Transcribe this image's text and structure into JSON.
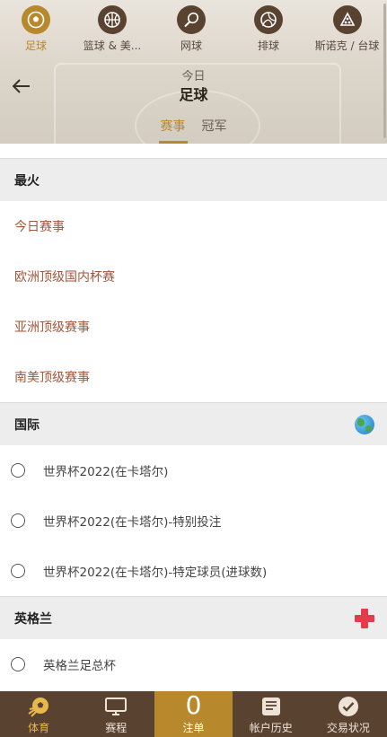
{
  "sports": [
    {
      "label": "足球",
      "icon": "soccer-ball-icon",
      "active": true
    },
    {
      "label": "篮球 & 美...",
      "icon": "basketball-icon",
      "active": false
    },
    {
      "label": "网球",
      "icon": "tennis-icon",
      "active": false
    },
    {
      "label": "排球",
      "icon": "volleyball-icon",
      "active": false
    },
    {
      "label": "斯诺克 / 台球",
      "icon": "snooker-icon",
      "active": false
    }
  ],
  "header": {
    "subtitle": "今日",
    "title": "足球"
  },
  "tabs": [
    {
      "label": "赛事",
      "active": true
    },
    {
      "label": "冠军",
      "active": false
    }
  ],
  "sections": {
    "hot": {
      "title": "最火",
      "items": [
        "今日赛事",
        "欧洲顶级国内杯赛",
        "亚洲顶级赛事",
        "南美顶级赛事"
      ]
    },
    "international": {
      "title": "国际",
      "icon": "globe-icon",
      "items": [
        "世界杯2022(在卡塔尔)",
        "世界杯2022(在卡塔尔)-特别投注",
        "世界杯2022(在卡塔尔)-特定球员(进球数)"
      ]
    },
    "england": {
      "title": "英格兰",
      "icon": "england-flag-icon",
      "items": [
        "英格兰足总杯"
      ]
    }
  },
  "bottom_nav": {
    "sports": "体育",
    "schedule": "赛程",
    "bet_count": "0",
    "bet_slip": "注单",
    "history": "帐户历史",
    "status": "交易状况"
  },
  "colors": {
    "accent": "#b8892c",
    "brown": "#5a4231",
    "link": "#a0573a",
    "section_bg": "#ededed"
  }
}
